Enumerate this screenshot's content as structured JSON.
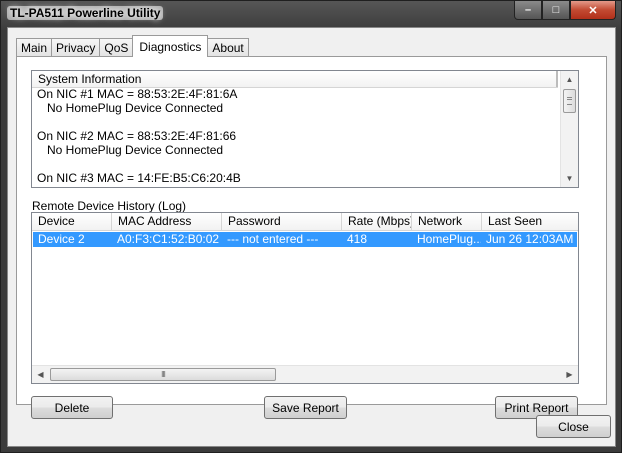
{
  "window": {
    "title": "TL-PA511 Powerline Utility",
    "controls": {
      "minimize": "–",
      "maximize": "□",
      "close": "✕"
    }
  },
  "tabs": [
    "Main",
    "Privacy",
    "QoS",
    "Diagnostics",
    "About"
  ],
  "active_tab": "Diagnostics",
  "system_info": {
    "header": "System Information",
    "lines": [
      "On NIC #1 MAC = 88:53:2E:4F:81:6A",
      "   No HomePlug Device Connected",
      "",
      "On NIC #2 MAC = 88:53:2E:4F:81:66",
      "   No HomePlug Device Connected",
      "",
      "On NIC #3 MAC = 14:FE:B5:C6:20:4B"
    ]
  },
  "remote_history": {
    "label": "Remote Device History (Log)",
    "columns": [
      "Device",
      "MAC Address",
      "Password",
      "Rate (Mbps)",
      "Network",
      "Last Seen"
    ],
    "rows": [
      {
        "device": "Device 2",
        "mac": "A0:F3:C1:52:B0:02",
        "password": "--- not entered ---",
        "rate": "418",
        "network": "HomePlug...",
        "last_seen": "Jun 26 12:03AM"
      }
    ],
    "scroll_grip": "III"
  },
  "buttons": {
    "delete": "Delete",
    "save_report": "Save Report",
    "print_report": "Print Report",
    "close": "Close"
  },
  "colors": {
    "selection": "#3399ff",
    "close_button": "#c24a32"
  }
}
